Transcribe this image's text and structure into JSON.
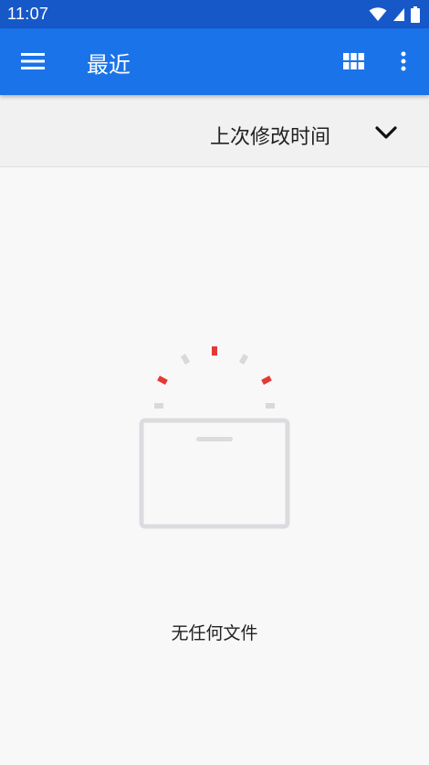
{
  "status_bar": {
    "time": "11:07",
    "icons": [
      "wifi-icon",
      "cell-signal-icon",
      "battery-icon"
    ]
  },
  "app_bar": {
    "title": "最近",
    "icons": [
      "menu-icon",
      "grid-view-icon",
      "more-vert-icon"
    ],
    "background_color": "#1a73e8"
  },
  "sort_bar": {
    "label": "上次修改时间",
    "toggle_icon": "chevron-down-icon"
  },
  "empty_state": {
    "message": "无任何文件",
    "illustration": "empty-folder-icon",
    "accent_color": "#e53935"
  }
}
